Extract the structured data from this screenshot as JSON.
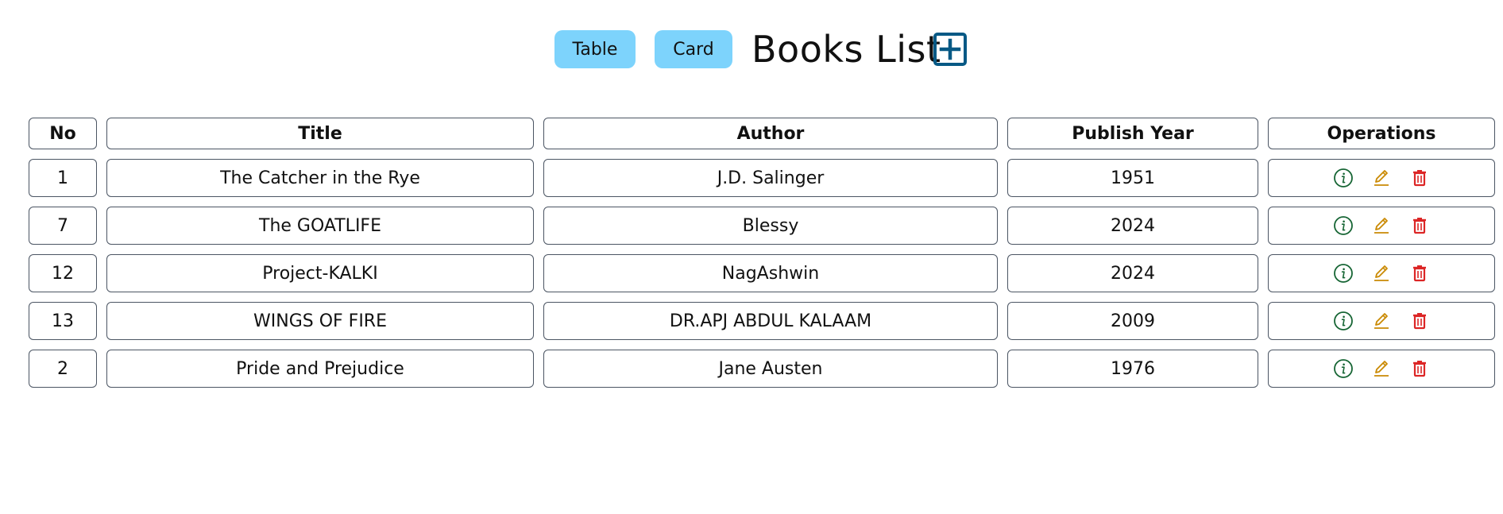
{
  "header": {
    "table_button": "Table",
    "card_button": "Card",
    "title": "Books List",
    "add_icon": "plus-square-icon"
  },
  "table": {
    "columns": [
      "No",
      "Title",
      "Author",
      "Publish Year",
      "Operations"
    ],
    "rows": [
      {
        "no": "1",
        "title": "The Catcher in the Rye",
        "author": "J.D. Salinger",
        "year": "1951"
      },
      {
        "no": "7",
        "title": "The GOATLIFE",
        "author": "Blessy",
        "year": "2024"
      },
      {
        "no": "12",
        "title": "Project-KALKI",
        "author": "NagAshwin",
        "year": "2024"
      },
      {
        "no": "13",
        "title": "WINGS OF FIRE",
        "author": "DR.APJ ABDUL KALAAM",
        "year": "2009"
      },
      {
        "no": "2",
        "title": "Pride and Prejudice",
        "author": "Jane Austen",
        "year": "1976"
      }
    ],
    "operation_icons": [
      "info-icon",
      "edit-icon",
      "delete-icon"
    ]
  },
  "colors": {
    "button_bg": "#7dd3fc",
    "add_icon": "#075985",
    "info": "#166534",
    "edit": "#ca8a04",
    "delete": "#dc2626",
    "border": "#4b5563"
  }
}
